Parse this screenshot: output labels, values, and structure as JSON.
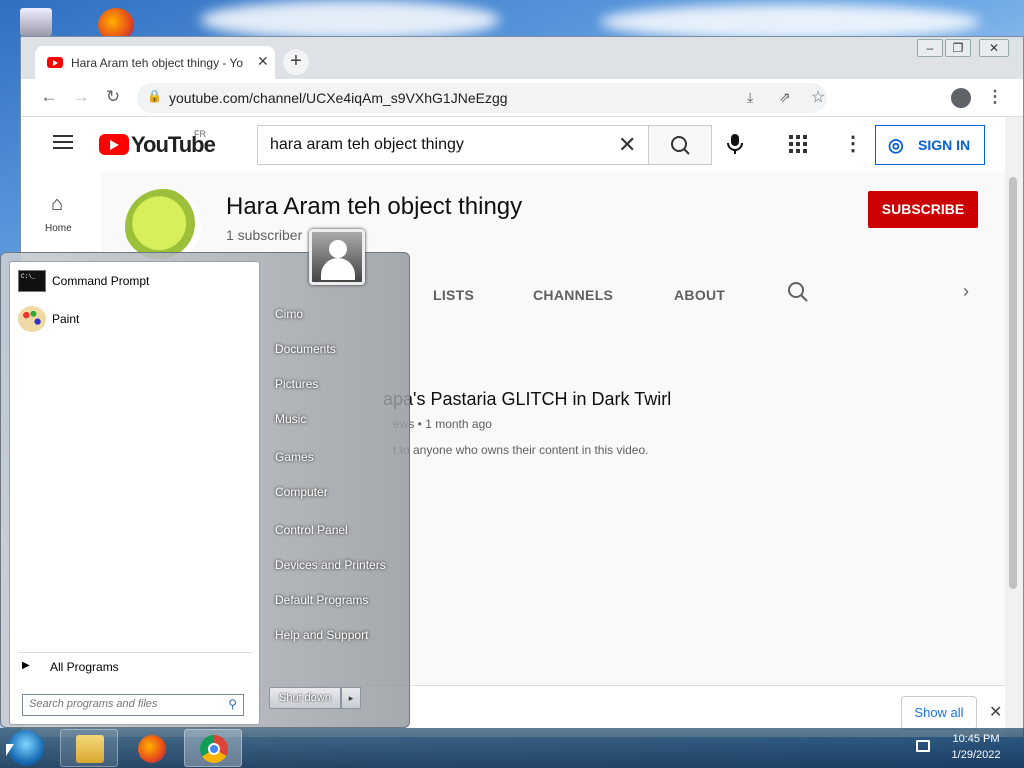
{
  "browser": {
    "tab_title": "Hara Aram teh object thingy - Yo",
    "url": "youtube.com/channel/UCXe4iqAm_s9VXhG1JNeEzgg"
  },
  "youtube": {
    "logo_text": "YouTube",
    "country": "FR",
    "search_value": "hara aram teh object thingy",
    "sign_in": "SIGN IN",
    "sidebar_home": "Home",
    "channel_name": "Hara Aram teh object thingy",
    "subscribers": "1 subscriber",
    "subscribe": "SUBSCRIBE",
    "tabs": [
      "LISTS",
      "CHANNELS",
      "ABOUT"
    ],
    "video_title": "apa's Pastaria GLITCH in Dark Twirl",
    "video_meta": "ews • 1 month ago",
    "video_note": "t to anyone who owns their content in this video.",
    "download_show_all": "Show all"
  },
  "start_menu": {
    "pinned": [
      "Command Prompt",
      "Paint"
    ],
    "all_programs": "All Programs",
    "search_placeholder": "Search programs and files",
    "right_links": [
      "Cimo",
      "Documents",
      "Pictures",
      "Music",
      "Games",
      "Computer",
      "Control Panel",
      "Devices and Printers",
      "Default Programs",
      "Help and Support"
    ],
    "shutdown": "Shut down"
  },
  "taskbar": {
    "time": "10:45 PM",
    "date": "1/29/2022"
  },
  "colors": {
    "youtube_red": "#ff0000",
    "subscribe_red": "#cc0000",
    "signin_blue": "#065fd4"
  }
}
